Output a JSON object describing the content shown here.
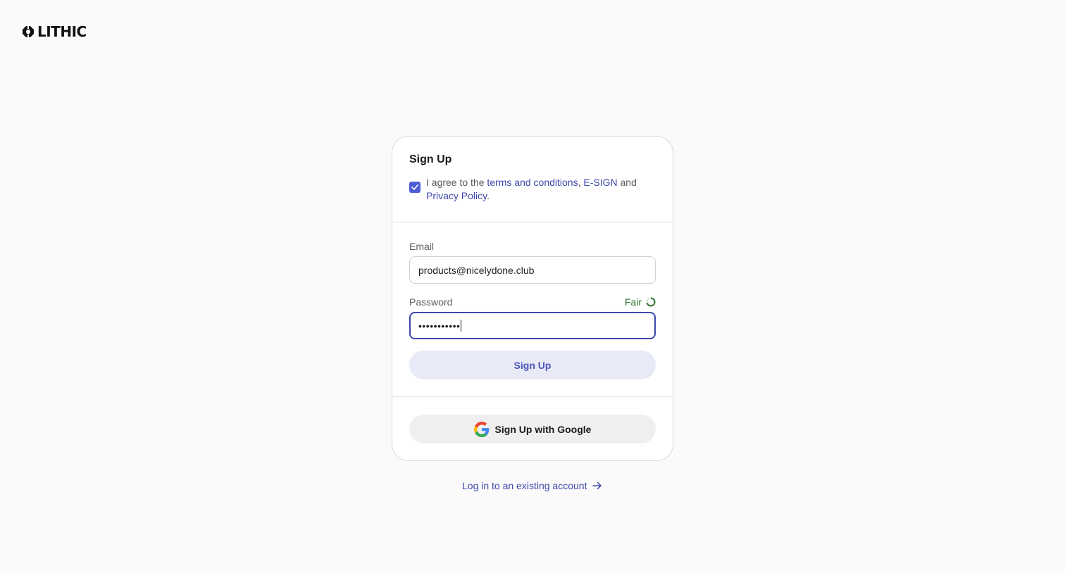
{
  "brand": {
    "name": "LITHIC"
  },
  "card": {
    "title": "Sign Up",
    "agreement": {
      "checked": true,
      "prefix": "I agree to the ",
      "terms_link": "terms and conditions",
      "separator": ", ",
      "esign_link": "E-SIGN",
      "and": " and ",
      "privacy_link": "Privacy Policy",
      "suffix": "."
    },
    "email": {
      "label": "Email",
      "value": "products@nicelydone.club"
    },
    "password": {
      "label": "Password",
      "value": "•••••••••••",
      "strength": "Fair",
      "focused": true
    },
    "submit_label": "Sign Up",
    "google_label": "Sign Up with Google"
  },
  "login_link": "Log in to an existing account",
  "colors": {
    "accent": "#3e47ad",
    "checkbox": "#4f5bd5",
    "strength_fair": "#2a6e2a",
    "primary_btn_bg": "#e8eaf8",
    "background": "#fafafa"
  }
}
